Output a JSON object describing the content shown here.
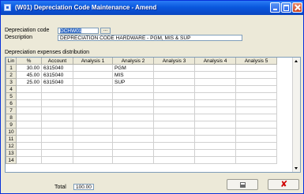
{
  "window": {
    "title": "(W01) Depreciation Code Maintenance - Amend"
  },
  "form": {
    "code_label": "Depreciation code",
    "code_value": "DCHW01",
    "browse_label": "...",
    "description_label": "Description",
    "description_value": "DEPRECIATION CODE HARDWARE - PGM, MIS & SUP"
  },
  "grid": {
    "section_label": "Depreciation expenses distribution",
    "columns": [
      "Lin",
      "%",
      "Account",
      "Analysis 1",
      "Analysis 2",
      "Analysis 3",
      "Analysis 4",
      "Analysis 5"
    ],
    "rows": [
      {
        "lin": "1",
        "pct": "30.00",
        "account": "6315040",
        "a1": "",
        "a2": "PGM",
        "a3": "",
        "a4": "",
        "a5": ""
      },
      {
        "lin": "2",
        "pct": "45.00",
        "account": "6315040",
        "a1": "",
        "a2": "MIS",
        "a3": "",
        "a4": "",
        "a5": ""
      },
      {
        "lin": "3",
        "pct": "25.00",
        "account": "6315040",
        "a1": "",
        "a2": "SUP",
        "a3": "",
        "a4": "",
        "a5": ""
      },
      {
        "lin": "4",
        "pct": "",
        "account": "",
        "a1": "",
        "a2": "",
        "a3": "",
        "a4": "",
        "a5": ""
      },
      {
        "lin": "5",
        "pct": "",
        "account": "",
        "a1": "",
        "a2": "",
        "a3": "",
        "a4": "",
        "a5": ""
      },
      {
        "lin": "6",
        "pct": "",
        "account": "",
        "a1": "",
        "a2": "",
        "a3": "",
        "a4": "",
        "a5": ""
      },
      {
        "lin": "7",
        "pct": "",
        "account": "",
        "a1": "",
        "a2": "",
        "a3": "",
        "a4": "",
        "a5": ""
      },
      {
        "lin": "8",
        "pct": "",
        "account": "",
        "a1": "",
        "a2": "",
        "a3": "",
        "a4": "",
        "a5": ""
      },
      {
        "lin": "9",
        "pct": "",
        "account": "",
        "a1": "",
        "a2": "",
        "a3": "",
        "a4": "",
        "a5": ""
      },
      {
        "lin": "10",
        "pct": "",
        "account": "",
        "a1": "",
        "a2": "",
        "a3": "",
        "a4": "",
        "a5": ""
      },
      {
        "lin": "11",
        "pct": "",
        "account": "",
        "a1": "",
        "a2": "",
        "a3": "",
        "a4": "",
        "a5": ""
      },
      {
        "lin": "12",
        "pct": "",
        "account": "",
        "a1": "",
        "a2": "",
        "a3": "",
        "a4": "",
        "a5": ""
      },
      {
        "lin": "13",
        "pct": "",
        "account": "",
        "a1": "",
        "a2": "",
        "a3": "",
        "a4": "",
        "a5": ""
      },
      {
        "lin": "14",
        "pct": "",
        "account": "",
        "a1": "",
        "a2": "",
        "a3": "",
        "a4": "",
        "a5": ""
      }
    ]
  },
  "footer": {
    "total_label": "Total",
    "total_value": "100.00"
  },
  "icons": {
    "save": "floppy-disk-icon",
    "cancel": "red-x-icon"
  },
  "colors": {
    "titlebar": "#0a58dd",
    "selection": "#316ac5",
    "cancel": "#d00000"
  }
}
